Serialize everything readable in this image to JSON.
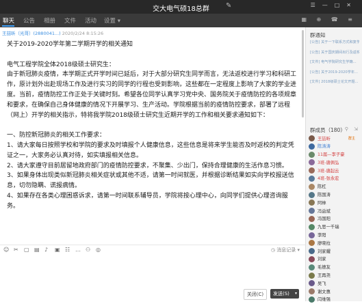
{
  "window": {
    "title": "交大电气硕18总群",
    "edit_icon": "✎",
    "controls": [
      "☰",
      "—",
      "□",
      "✕"
    ]
  },
  "tabs": [
    "聊天",
    "公告",
    "相册",
    "文件",
    "活动",
    "设置 ▾"
  ],
  "tabs_right_icons": "▦ ⊕ ☎ ≡",
  "message": {
    "sender": "王喆昕（光哥）",
    "qq": "(2880041...)",
    "time": "2020/2/24 8:15:26",
    "lines": [
      "关于2019-2020学年第二学期开学的相关通知",
      "",
      "电气工程学院全体2018级硕士研究生：",
      "由于新冠肺炎疫情，本学期正式开学时间已延后，对于大部分研究生同学而言，无法返校进行学习和科研工作，原计划外出赴现场工作及进行实习的同学的行程也受到影响，这些都在一定程度上影响了大家的学业进度。当前，疫情防控工作正处于关键时刻。希望各位同学认真学习党中央、国务院关于疫情防控的各项规章和要求，在确保自己身体健康的情况下开展学习、生产活动。学院根据当前的疫情防控要求，部署了远程（网上）开学的相关指示，特将我学院2018级硕士研究生近期开学的工作和相关要求通知如下：",
      "",
      "一、防控新冠肺炎的相关工作要求：",
      "1、请大家每日按照学校和学院的要求及时填报个人健康信息，这些信息是将来学生能否及时返校的判定凭证之一，大家务必认真对待，如实填报相关信息。",
      "2、请大家遵守目前居留地政府部门的疫情防控要求，不聚集、少出门，保持合理健康的生活作息习惯。",
      "3、如果身体出现类似新冠肺炎相关症状或其他不适，请第一时间就医，并根据诊断结果如实向学校报送信息，切勿隐瞒、谎报病情。",
      "4、如果存在各类心理困惑诉求，请第一时间联系辅导员，学院将按心理中心，向同学们提供心理咨询服务。"
    ]
  },
  "toolbar": {
    "icons": [
      "☺",
      "✂",
      "▢",
      "▤",
      "♪",
      "▣",
      "☷",
      "…",
      "⚇",
      "◎"
    ],
    "history": "◷ 消息记录 ▾"
  },
  "buttons": {
    "close": "关闭(C)",
    "send": "发送(S)",
    "send_arrow": "▾"
  },
  "notice": {
    "title": "群通知",
    "items": [
      "[公告] 关于一下联系方式和复学...",
      "[公告] 关于国庆期间出行及返校...",
      "[文件] 电气学院研究生学籍...",
      "[公告] 关于2019-2020学年...",
      "[文件] 2018级硕士论文开题..."
    ]
  },
  "members": {
    "title": "群成员（180）",
    "icons": "⚲ ⇲",
    "list": [
      {
        "name": "王喆昕",
        "style": "red",
        "tag": "群主",
        "tag2": "",
        "avatar": "#7a5a4a"
      },
      {
        "name": "陈涛涛",
        "style": "blue",
        "tag": "",
        "tag2": "",
        "avatar": "#3f6aa0"
      },
      {
        "name": "11届—李子豪",
        "style": "red",
        "tag": "",
        "tag2": "",
        "avatar": "#6a8a6a"
      },
      {
        "name": "3班-唐佩弘",
        "style": "red",
        "tag": "",
        "tag2": "",
        "avatar": "#8a6a9a"
      },
      {
        "name": "3班-唐起云",
        "style": "red",
        "tag": "",
        "tag2": "",
        "avatar": "#9a6a5a"
      },
      {
        "name": "4班-张永宏",
        "style": "red",
        "tag": "",
        "tag2": "",
        "avatar": "#5a7a9a"
      },
      {
        "name": "陈杠",
        "style": "plain",
        "tag": "",
        "tag2": "",
        "avatar": "#aa8866"
      },
      {
        "name": "陈国涛",
        "style": "plain",
        "tag": "",
        "tag2": "",
        "avatar": "#557788"
      },
      {
        "name": "阿林",
        "style": "plain",
        "tag": "",
        "tag2": "",
        "avatar": "#887755"
      },
      {
        "name": "冯益斌",
        "style": "plain",
        "tag": "",
        "tag2": "",
        "avatar": "#667799"
      },
      {
        "name": "冯国阳",
        "style": "plain",
        "tag": "",
        "tag2": "",
        "avatar": "#996655"
      },
      {
        "name": "九思一千瑞",
        "style": "plain",
        "tag": "",
        "tag2": "",
        "avatar": "#558866"
      },
      {
        "name": "李阳",
        "style": "plain",
        "tag": "",
        "tag2": "",
        "avatar": "#776699"
      },
      {
        "name": "廖晓拉",
        "style": "plain",
        "tag": "",
        "tag2": "",
        "avatar": "#aa7744"
      },
      {
        "name": "刘家耀",
        "style": "plain",
        "tag": "",
        "tag2": "",
        "avatar": "#4a6a8a"
      },
      {
        "name": "刘家",
        "style": "plain",
        "tag": "",
        "tag2": "",
        "avatar": "#8a4a5a"
      },
      {
        "name": "毛德友",
        "style": "plain",
        "tag": "",
        "tag2": "",
        "avatar": "#5a8a7a"
      },
      {
        "name": "王再尧",
        "style": "plain",
        "tag": "",
        "tag2": "",
        "avatar": "#7a7a4a"
      },
      {
        "name": "吴飞",
        "style": "plain",
        "tag": "",
        "tag2": "",
        "avatar": "#6a5a8a"
      },
      {
        "name": "谢文惠",
        "style": "plain",
        "tag": "",
        "tag2": "",
        "avatar": "#9a7a6a"
      },
      {
        "name": "闫维强",
        "style": "plain",
        "tag": "",
        "tag2": "",
        "avatar": "#4a7a6a"
      }
    ]
  }
}
